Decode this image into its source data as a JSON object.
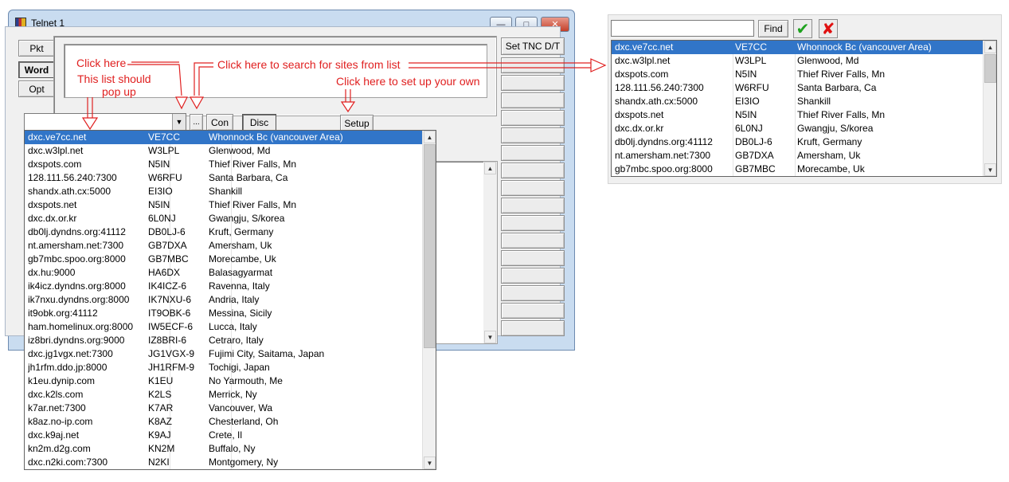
{
  "window": {
    "title": "Telnet 1",
    "minimize": "—",
    "maximize": "□",
    "close": "✕"
  },
  "left_buttons": {
    "pkt": "Pkt",
    "word": "Word",
    "opt": "Opt"
  },
  "right_button": "Set TNC D/T",
  "connect_bar": {
    "browse": "...",
    "con": "Con",
    "disc": "Disc",
    "setup": "Setup",
    "combo_arrow": "▼"
  },
  "annotations": {
    "click_here": "Click here",
    "list_popup_1": "This list should",
    "list_popup_2": "pop up",
    "search_sites": "Click here to search for sites from list",
    "setup_own": "Click here to set up your own"
  },
  "scroll_arrows": {
    "up": "▲",
    "down": "▼"
  },
  "dropdown_rows": [
    [
      "dxc.ve7cc.net",
      "VE7CC",
      "Whonnock Bc (vancouver Area)"
    ],
    [
      "dxc.w3lpl.net",
      "W3LPL",
      "Glenwood, Md"
    ],
    [
      "dxspots.com",
      "N5IN",
      "Thief River Falls, Mn"
    ],
    [
      "128.111.56.240:7300",
      "W6RFU",
      "Santa Barbara, Ca"
    ],
    [
      "shandx.ath.cx:5000",
      "EI3IO",
      "Shankill"
    ],
    [
      "dxspots.net",
      "N5IN",
      "Thief River Falls, Mn"
    ],
    [
      "dxc.dx.or.kr",
      "6L0NJ",
      "Gwangju, S/korea"
    ],
    [
      "db0lj.dyndns.org:41112",
      "DB0LJ-6",
      "Kruft, Germany"
    ],
    [
      "nt.amersham.net:7300",
      "GB7DXA",
      "Amersham, Uk"
    ],
    [
      "gb7mbc.spoo.org:8000",
      "GB7MBC",
      "Morecambe, Uk"
    ],
    [
      "dx.hu:9000",
      "HA6DX",
      "Balasagyarmat"
    ],
    [
      "ik4icz.dyndns.org:8000",
      "IK4ICZ-6",
      "Ravenna, Italy"
    ],
    [
      "ik7nxu.dyndns.org:8000",
      "IK7NXU-6",
      "Andria, Italy"
    ],
    [
      "it9obk.org:41112",
      "IT9OBK-6",
      "Messina, Sicily"
    ],
    [
      "ham.homelinux.org:8000",
      "IW5ECF-6",
      "Lucca, Italy"
    ],
    [
      "iz8bri.dyndns.org:9000",
      "IZ8BRI-6",
      "Cetraro, Italy"
    ],
    [
      "dxc.jg1vgx.net:7300",
      "JG1VGX-9",
      "Fujimi City,  Saitama, Japan"
    ],
    [
      "jh1rfm.ddo.jp:8000",
      "JH1RFM-9",
      "Tochigi,  Japan"
    ],
    [
      "k1eu.dynip.com",
      "K1EU",
      "No Yarmouth, Me"
    ],
    [
      "dxc.k2ls.com",
      "K2LS",
      "Merrick, Ny"
    ],
    [
      "k7ar.net:7300",
      "K7AR",
      "Vancouver, Wa"
    ],
    [
      "k8az.no-ip.com",
      "K8AZ",
      "Chesterland, Oh"
    ],
    [
      "dxc.k9aj.net",
      "K9AJ",
      "Crete, Il"
    ],
    [
      "kn2m.d2g.com",
      "KN2M",
      "Buffalo, Ny"
    ],
    [
      "dxc.n2ki.com:7300",
      "N2KI",
      "Montgomery, Ny"
    ]
  ],
  "right_panel": {
    "find": "Find",
    "ok": "✔",
    "cancel": "✘",
    "rows": [
      [
        "dxc.ve7cc.net",
        "VE7CC",
        "Whonnock Bc (vancouver Area)"
      ],
      [
        "dxc.w3lpl.net",
        "W3LPL",
        "Glenwood, Md"
      ],
      [
        "dxspots.com",
        "N5IN",
        "Thief River Falls, Mn"
      ],
      [
        "128.111.56.240:7300",
        "W6RFU",
        "Santa Barbara, Ca"
      ],
      [
        "shandx.ath.cx:5000",
        "EI3IO",
        "Shankill"
      ],
      [
        "dxspots.net",
        "N5IN",
        "Thief River Falls, Mn"
      ],
      [
        "dxc.dx.or.kr",
        "6L0NJ",
        "Gwangju, S/korea"
      ],
      [
        "db0lj.dyndns.org:41112",
        "DB0LJ-6",
        "Kruft, Germany"
      ],
      [
        "nt.amersham.net:7300",
        "GB7DXA",
        "Amersham, Uk"
      ],
      [
        "gb7mbc.spoo.org:8000",
        "GB7MBC",
        "Morecambe, Uk"
      ]
    ]
  },
  "colors": {
    "selection": "#3175c8",
    "annotation": "#e02020",
    "ok_check": "#1ea21e",
    "cancel_x": "#e01010",
    "window_frame": "#c9dcf0"
  }
}
